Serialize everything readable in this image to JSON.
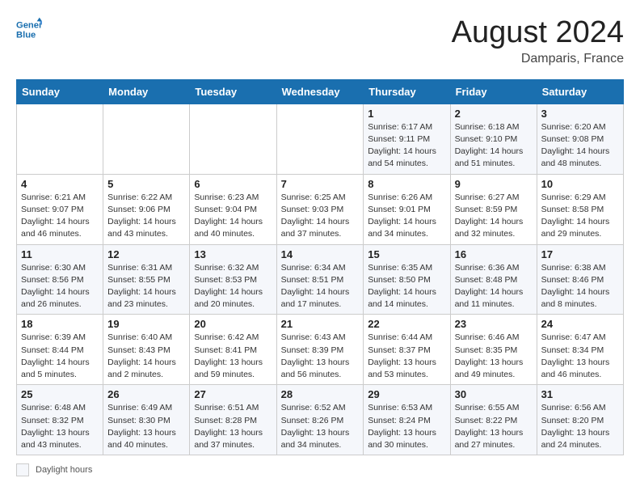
{
  "header": {
    "title": "August 2024",
    "location": "Damparis, France",
    "logo_line1": "General",
    "logo_line2": "Blue"
  },
  "calendar": {
    "weekdays": [
      "Sunday",
      "Monday",
      "Tuesday",
      "Wednesday",
      "Thursday",
      "Friday",
      "Saturday"
    ],
    "weeks": [
      [
        {
          "day": "",
          "info": ""
        },
        {
          "day": "",
          "info": ""
        },
        {
          "day": "",
          "info": ""
        },
        {
          "day": "",
          "info": ""
        },
        {
          "day": "1",
          "info": "Sunrise: 6:17 AM\nSunset: 9:11 PM\nDaylight: 14 hours and 54 minutes."
        },
        {
          "day": "2",
          "info": "Sunrise: 6:18 AM\nSunset: 9:10 PM\nDaylight: 14 hours and 51 minutes."
        },
        {
          "day": "3",
          "info": "Sunrise: 6:20 AM\nSunset: 9:08 PM\nDaylight: 14 hours and 48 minutes."
        }
      ],
      [
        {
          "day": "4",
          "info": "Sunrise: 6:21 AM\nSunset: 9:07 PM\nDaylight: 14 hours and 46 minutes."
        },
        {
          "day": "5",
          "info": "Sunrise: 6:22 AM\nSunset: 9:06 PM\nDaylight: 14 hours and 43 minutes."
        },
        {
          "day": "6",
          "info": "Sunrise: 6:23 AM\nSunset: 9:04 PM\nDaylight: 14 hours and 40 minutes."
        },
        {
          "day": "7",
          "info": "Sunrise: 6:25 AM\nSunset: 9:03 PM\nDaylight: 14 hours and 37 minutes."
        },
        {
          "day": "8",
          "info": "Sunrise: 6:26 AM\nSunset: 9:01 PM\nDaylight: 14 hours and 34 minutes."
        },
        {
          "day": "9",
          "info": "Sunrise: 6:27 AM\nSunset: 8:59 PM\nDaylight: 14 hours and 32 minutes."
        },
        {
          "day": "10",
          "info": "Sunrise: 6:29 AM\nSunset: 8:58 PM\nDaylight: 14 hours and 29 minutes."
        }
      ],
      [
        {
          "day": "11",
          "info": "Sunrise: 6:30 AM\nSunset: 8:56 PM\nDaylight: 14 hours and 26 minutes."
        },
        {
          "day": "12",
          "info": "Sunrise: 6:31 AM\nSunset: 8:55 PM\nDaylight: 14 hours and 23 minutes."
        },
        {
          "day": "13",
          "info": "Sunrise: 6:32 AM\nSunset: 8:53 PM\nDaylight: 14 hours and 20 minutes."
        },
        {
          "day": "14",
          "info": "Sunrise: 6:34 AM\nSunset: 8:51 PM\nDaylight: 14 hours and 17 minutes."
        },
        {
          "day": "15",
          "info": "Sunrise: 6:35 AM\nSunset: 8:50 PM\nDaylight: 14 hours and 14 minutes."
        },
        {
          "day": "16",
          "info": "Sunrise: 6:36 AM\nSunset: 8:48 PM\nDaylight: 14 hours and 11 minutes."
        },
        {
          "day": "17",
          "info": "Sunrise: 6:38 AM\nSunset: 8:46 PM\nDaylight: 14 hours and 8 minutes."
        }
      ],
      [
        {
          "day": "18",
          "info": "Sunrise: 6:39 AM\nSunset: 8:44 PM\nDaylight: 14 hours and 5 minutes."
        },
        {
          "day": "19",
          "info": "Sunrise: 6:40 AM\nSunset: 8:43 PM\nDaylight: 14 hours and 2 minutes."
        },
        {
          "day": "20",
          "info": "Sunrise: 6:42 AM\nSunset: 8:41 PM\nDaylight: 13 hours and 59 minutes."
        },
        {
          "day": "21",
          "info": "Sunrise: 6:43 AM\nSunset: 8:39 PM\nDaylight: 13 hours and 56 minutes."
        },
        {
          "day": "22",
          "info": "Sunrise: 6:44 AM\nSunset: 8:37 PM\nDaylight: 13 hours and 53 minutes."
        },
        {
          "day": "23",
          "info": "Sunrise: 6:46 AM\nSunset: 8:35 PM\nDaylight: 13 hours and 49 minutes."
        },
        {
          "day": "24",
          "info": "Sunrise: 6:47 AM\nSunset: 8:34 PM\nDaylight: 13 hours and 46 minutes."
        }
      ],
      [
        {
          "day": "25",
          "info": "Sunrise: 6:48 AM\nSunset: 8:32 PM\nDaylight: 13 hours and 43 minutes."
        },
        {
          "day": "26",
          "info": "Sunrise: 6:49 AM\nSunset: 8:30 PM\nDaylight: 13 hours and 40 minutes."
        },
        {
          "day": "27",
          "info": "Sunrise: 6:51 AM\nSunset: 8:28 PM\nDaylight: 13 hours and 37 minutes."
        },
        {
          "day": "28",
          "info": "Sunrise: 6:52 AM\nSunset: 8:26 PM\nDaylight: 13 hours and 34 minutes."
        },
        {
          "day": "29",
          "info": "Sunrise: 6:53 AM\nSunset: 8:24 PM\nDaylight: 13 hours and 30 minutes."
        },
        {
          "day": "30",
          "info": "Sunrise: 6:55 AM\nSunset: 8:22 PM\nDaylight: 13 hours and 27 minutes."
        },
        {
          "day": "31",
          "info": "Sunrise: 6:56 AM\nSunset: 8:20 PM\nDaylight: 13 hours and 24 minutes."
        }
      ]
    ]
  },
  "footer": {
    "daylight_label": "Daylight hours"
  }
}
